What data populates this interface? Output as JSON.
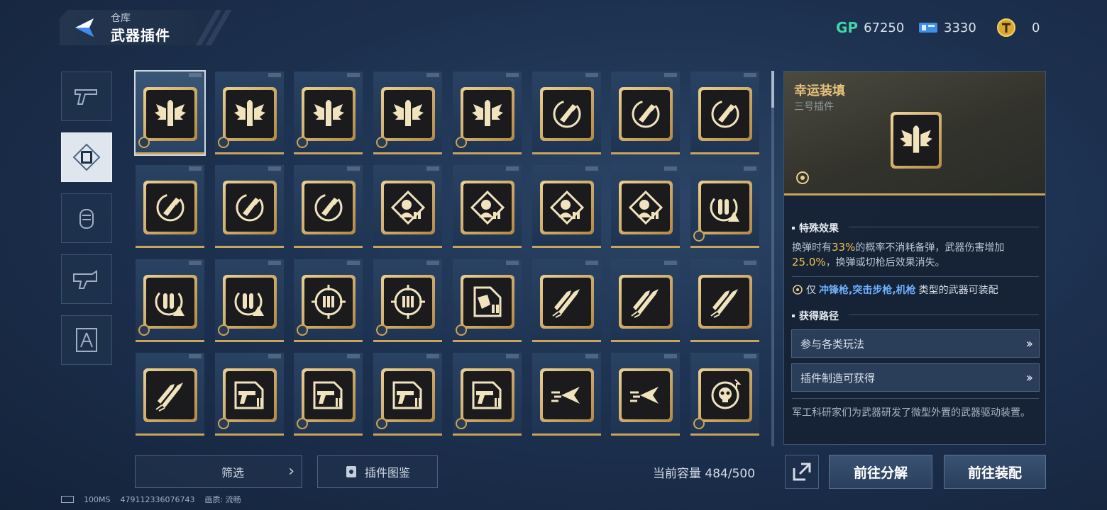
{
  "header": {
    "breadcrumb": "仓库",
    "title": "武器插件"
  },
  "currencies": [
    {
      "icon": "gp-icon",
      "label": "GP",
      "value": "67250"
    },
    {
      "icon": "ticket-icon",
      "value": "3330"
    },
    {
      "icon": "token-icon",
      "value": "0"
    }
  ],
  "categories": [
    {
      "name": "pistol",
      "active": false
    },
    {
      "name": "plugin",
      "active": true
    },
    {
      "name": "grenade",
      "active": false
    },
    {
      "name": "gear",
      "active": false
    },
    {
      "name": "blueprint",
      "active": false
    }
  ],
  "grid": {
    "items": [
      {
        "icon": "winged-bullet",
        "badge": true,
        "selected": true
      },
      {
        "icon": "winged-bullet",
        "badge": true
      },
      {
        "icon": "winged-bullet",
        "badge": true
      },
      {
        "icon": "winged-bullet",
        "badge": true
      },
      {
        "icon": "winged-bullet",
        "badge": true
      },
      {
        "icon": "reload-cycle",
        "badge": false
      },
      {
        "icon": "reload-cycle",
        "badge": false
      },
      {
        "icon": "reload-cycle",
        "badge": false
      },
      {
        "icon": "reload-cycle",
        "badge": false
      },
      {
        "icon": "reload-cycle",
        "badge": false
      },
      {
        "icon": "reload-cycle",
        "badge": false
      },
      {
        "icon": "head-target",
        "badge": false
      },
      {
        "icon": "head-target",
        "badge": false
      },
      {
        "icon": "head-target",
        "badge": false
      },
      {
        "icon": "head-target",
        "badge": false
      },
      {
        "icon": "ammo-warning",
        "badge": true
      },
      {
        "icon": "ammo-warning",
        "badge": true
      },
      {
        "icon": "ammo-warning",
        "badge": true
      },
      {
        "icon": "crosshair-ammo",
        "badge": true
      },
      {
        "icon": "crosshair-ammo",
        "badge": true
      },
      {
        "icon": "hand-ammo",
        "badge": true
      },
      {
        "icon": "rocket-bullets",
        "badge": false
      },
      {
        "icon": "rocket-bullets",
        "badge": false
      },
      {
        "icon": "rocket-bullets",
        "badge": false
      },
      {
        "icon": "rocket-bullets",
        "badge": false
      },
      {
        "icon": "gun-ammo",
        "badge": true
      },
      {
        "icon": "gun-ammo",
        "badge": true
      },
      {
        "icon": "gun-ammo",
        "badge": true
      },
      {
        "icon": "gun-ammo",
        "badge": true
      },
      {
        "icon": "dash-arrow",
        "badge": false
      },
      {
        "icon": "dash-arrow",
        "badge": false
      },
      {
        "icon": "skull-target",
        "badge": true
      }
    ]
  },
  "bottom": {
    "filter_label": "筛选",
    "codex_label": "插件图鉴",
    "capacity_label": "当前容量",
    "capacity_value": "484/500"
  },
  "status": {
    "ping": "100MS",
    "uid": "479112336076743",
    "quality_label": "画质:",
    "quality_value": "流畅"
  },
  "detail": {
    "name": "幸运装填",
    "subtitle": "三号插件",
    "effect_heading": "特殊效果",
    "effect_p1": "换弹时有",
    "effect_v1": "33%",
    "effect_p2": "的概率不消耗备弹，武器伤害增加",
    "effect_v2": "25.0%",
    "effect_p3": "，换弹或切枪后效果消失。",
    "weapon_prefix": "仅",
    "weapon_types": "冲锋枪,突击步枪,机枪",
    "weapon_suffix": "类型的武器可装配",
    "route_heading": "获得路径",
    "routes": [
      {
        "label": "参与各类玩法"
      },
      {
        "label": "插件制造可获得"
      }
    ],
    "lore": "军工科研家们为武器研发了微型外置的武器驱动装置。",
    "btn_dismantle": "前往分解",
    "btn_equip": "前往装配"
  },
  "colors": {
    "gold": "#c9a45d",
    "highlight": "#f0c250",
    "weapon_blue": "#6fb0ff",
    "gp_green": "#3fd6a8"
  }
}
